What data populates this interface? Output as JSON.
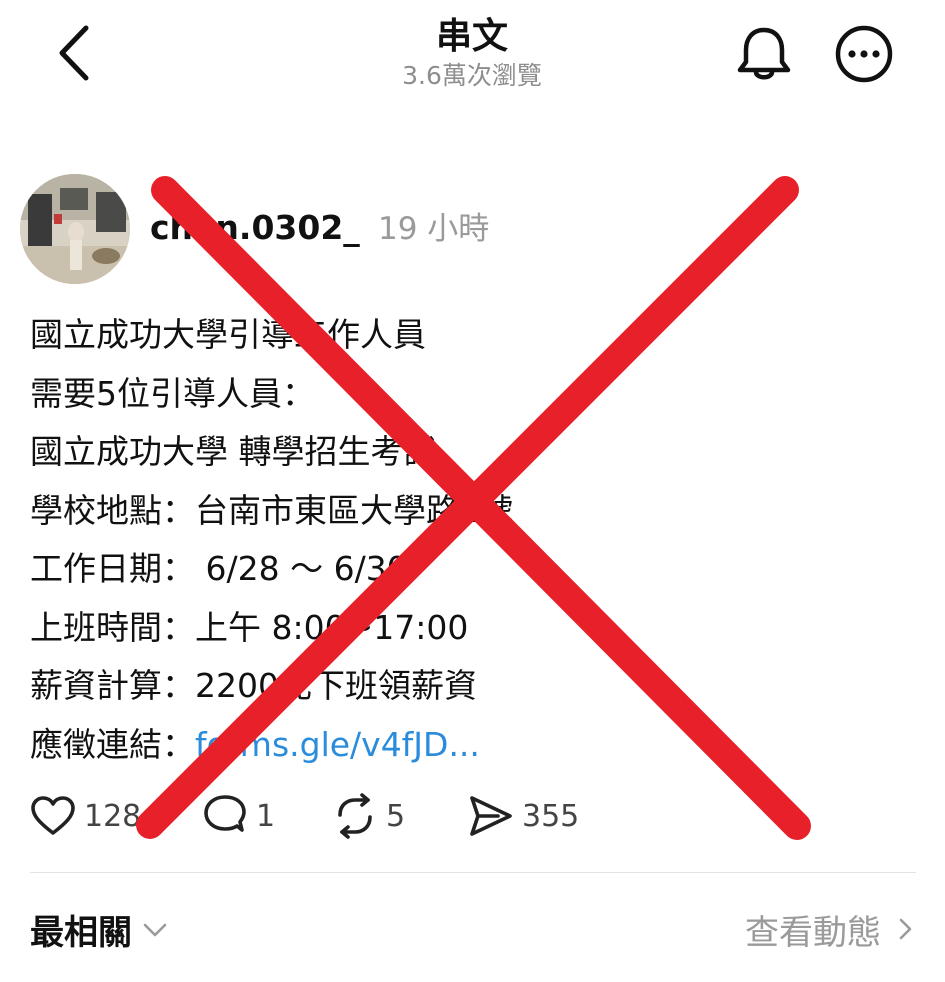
{
  "header": {
    "title": "串文",
    "views": "3.6萬次瀏覽",
    "back_icon": "chevron-left-icon",
    "bell_icon": "bell-icon",
    "more_icon": "more-circle-icon"
  },
  "post": {
    "username": "chen.0302_",
    "time_ago": "19 小時",
    "lines": [
      "國立成功大學引導工作人員",
      "需要5位引導人員：",
      "國立成功大學  轉學招生考試",
      "學校地點：台南市東區大學路1號",
      "工作日期：  6/28 ～ 6/30",
      "上班時間：上午 8:00~17:00",
      "薪資計算：2200元下班領薪資"
    ],
    "link_prefix": "應徵連結：",
    "link_text": "forms.gle/v4fJD...",
    "actions": {
      "likes": "128",
      "replies": "1",
      "reposts": "5",
      "shares": "355"
    }
  },
  "footer": {
    "sort_label": "最相關",
    "view_activity": "查看動態"
  },
  "colors": {
    "link": "#2a8cdc",
    "cross": "#e8202a",
    "muted": "#9a9a9a"
  }
}
